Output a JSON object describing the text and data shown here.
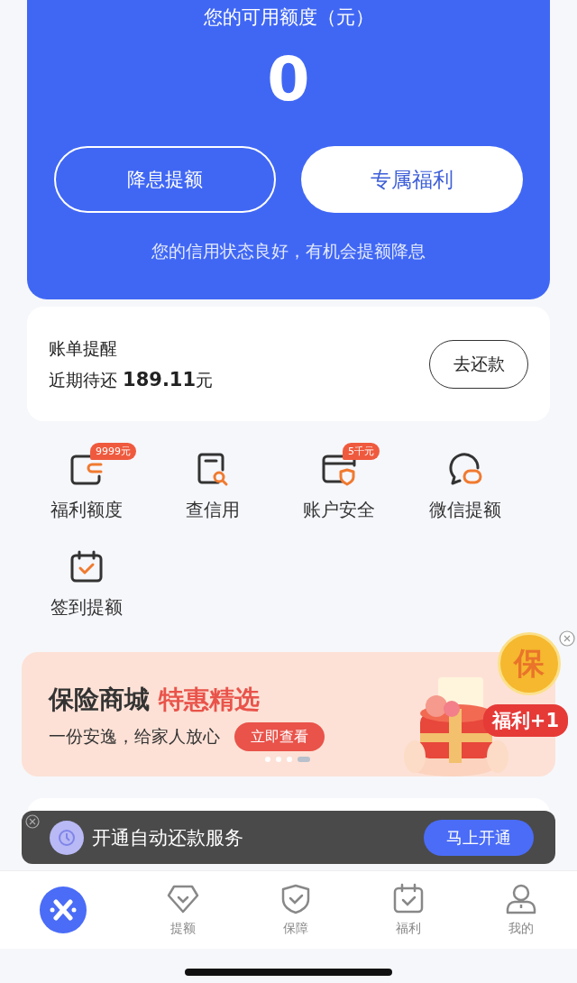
{
  "credit_card": {
    "title": "您的可用额度（元）",
    "amount": "0",
    "buttons": [
      {
        "label": "降息提额",
        "kind": "outline"
      },
      {
        "label": "专属福利",
        "kind": "solid"
      }
    ],
    "status": "您的信用状态良好，有机会提额降息"
  },
  "bill": {
    "title": "账单提醒",
    "due_label": "近期待还",
    "due_amount": "189.11",
    "due_unit": "元",
    "button": "去还款"
  },
  "services": [
    {
      "label": "福利额度",
      "badge": "9999元"
    },
    {
      "label": "查信用"
    },
    {
      "label": "账户安全",
      "badge": "5千元"
    },
    {
      "label": "微信提额"
    },
    {
      "label": "签到提额"
    }
  ],
  "banner": {
    "title": "保险商城",
    "highlight": "特惠精选",
    "subtitle": "一份安逸，给家人放心",
    "button": "立即查看",
    "coin_label": "保",
    "bonus": "福利+1",
    "dots": [
      {
        "selected": false
      },
      {
        "selected": false
      },
      {
        "selected": false
      },
      {
        "selected": true
      }
    ]
  },
  "toast": {
    "text": "开通自动还款服务",
    "button": "马上开通"
  },
  "tab_bar": [
    {
      "selected": true
    },
    {
      "label": "提额",
      "selected": false
    },
    {
      "label": "保障",
      "selected": false
    },
    {
      "label": "福利",
      "selected": false
    },
    {
      "label": "我的",
      "selected": false
    }
  ]
}
